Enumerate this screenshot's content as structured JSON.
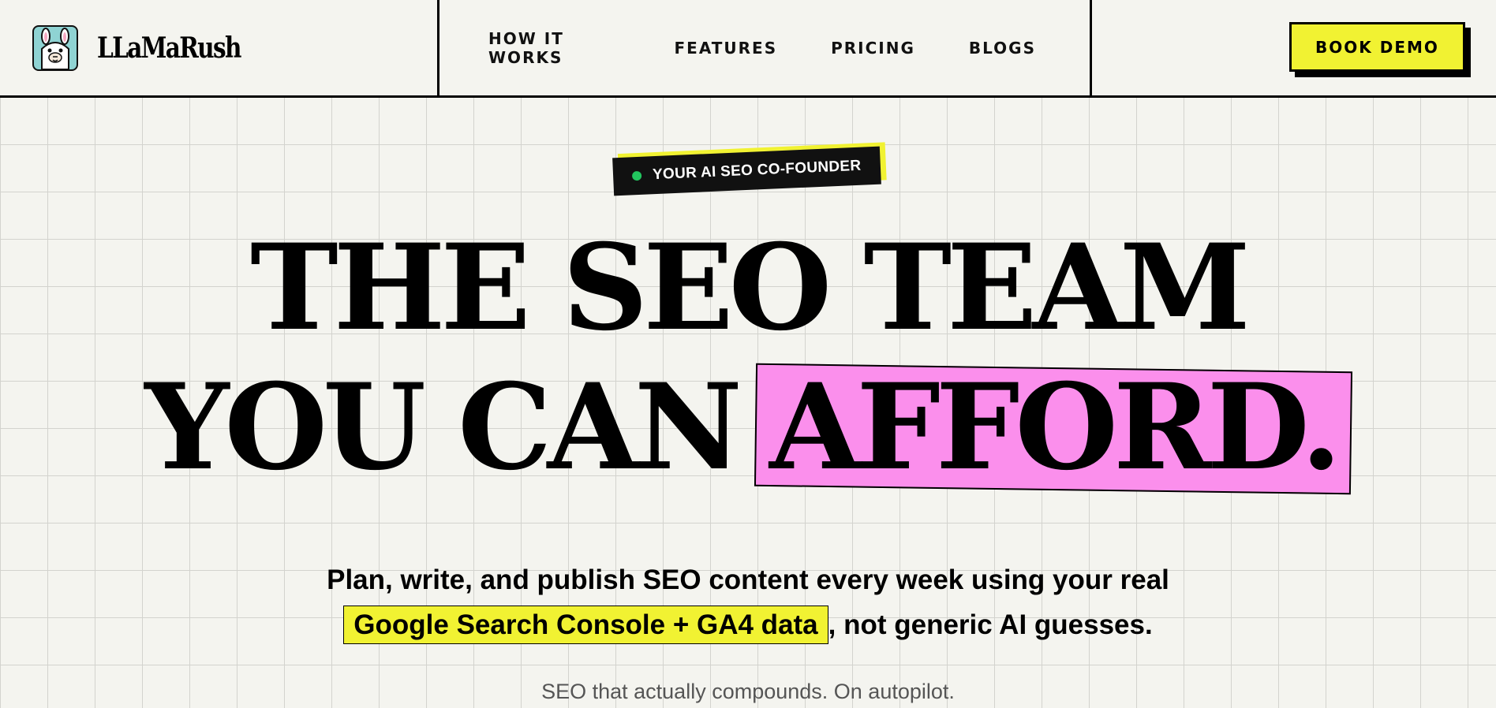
{
  "brand": {
    "name": "LLaMaRush",
    "logo_icon": "llama-icon"
  },
  "nav": {
    "items": [
      "HOW IT WORKS",
      "FEATURES",
      "PRICING",
      "BLOGS"
    ]
  },
  "cta": {
    "book_demo": "BOOK DEMO"
  },
  "hero": {
    "badge": "YOUR AI SEO CO-FOUNDER",
    "headline_line1": "THE SEO TEAM",
    "headline_line2_plain": "YOU CAN",
    "headline_line2_highlight": "AFFORD.",
    "sub_line1": "Plan, write, and publish SEO content every week using your real",
    "sub_highlight": "Google Search Console + GA4 data",
    "sub_line2_rest": ", not generic AI guesses.",
    "tagline": "SEO that actually compounds. On autopilot."
  },
  "colors": {
    "background": "#f4f4ef",
    "accent_yellow": "#f1f232",
    "accent_pink": "#fb8fec",
    "dot_green": "#22c55e"
  }
}
